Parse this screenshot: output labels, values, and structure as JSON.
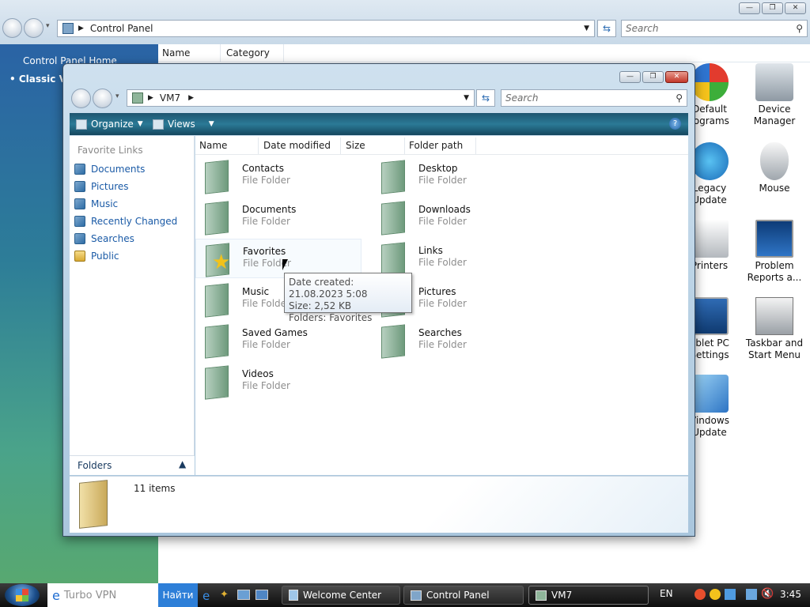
{
  "control_panel": {
    "address": "Control Panel",
    "search_placeholder": "Search",
    "sidebar": {
      "home": "Control Panel Home",
      "classic": "Classic Vi"
    },
    "columns": [
      "Name",
      "Category"
    ],
    "icons": [
      {
        "label": "Default\nrograms",
        "icon": "default-programs-icon"
      },
      {
        "label": "Device\nManager",
        "icon": "device-manager-icon"
      },
      {
        "label": "Legacy\nUpdate",
        "icon": "legacy-update-icon"
      },
      {
        "label": "Mouse",
        "icon": "mouse-icon"
      },
      {
        "label": "Printers",
        "icon": "printer-icon"
      },
      {
        "label": "Problem\nReports a...",
        "icon": "problem-reports-icon"
      },
      {
        "label": "ablet PC\nSettings",
        "icon": "tablet-pc-icon"
      },
      {
        "label": "Taskbar and\nStart Menu",
        "icon": "taskbar-icon"
      },
      {
        "label": "Vindows\nUpdate",
        "icon": "windows-update-icon"
      }
    ]
  },
  "window": {
    "address": "VM7",
    "search_placeholder": "Search",
    "toolbar": {
      "organize": "Organize",
      "views": "Views"
    },
    "favorite_links_header": "Favorite Links",
    "favorite_links": [
      "Documents",
      "Pictures",
      "Music",
      "Recently Changed",
      "Searches",
      "Public"
    ],
    "folders_label": "Folders",
    "columns": [
      "Name",
      "Date modified",
      "Size",
      "Folder path"
    ],
    "items": [
      {
        "name": "Contacts",
        "type": "File Folder"
      },
      {
        "name": "Desktop",
        "type": "File Folder"
      },
      {
        "name": "Documents",
        "type": "File Folder"
      },
      {
        "name": "Downloads",
        "type": "File Folder"
      },
      {
        "name": "Favorites",
        "type": "File Folder"
      },
      {
        "name": "Links",
        "type": "File Folder"
      },
      {
        "name": "Music",
        "type": "File Folder"
      },
      {
        "name": "Pictures",
        "type": "File Folder"
      },
      {
        "name": "Saved Games",
        "type": "File Folder"
      },
      {
        "name": "Searches",
        "type": "File Folder"
      },
      {
        "name": "Videos",
        "type": "File Folder"
      }
    ],
    "tooltip": {
      "line1": "Date created: 21.08.2023 5:08",
      "line2": "Size: 2,52 KB",
      "line3": "Folders: Favorites"
    },
    "details": {
      "count": "11 items"
    }
  },
  "taskbar": {
    "quick_launch_vpn": "Turbo VPN",
    "find_button": "Найти",
    "buttons": [
      "Welcome Center",
      "Control Panel",
      "VM7"
    ],
    "language": "EN",
    "clock": "3:45"
  }
}
